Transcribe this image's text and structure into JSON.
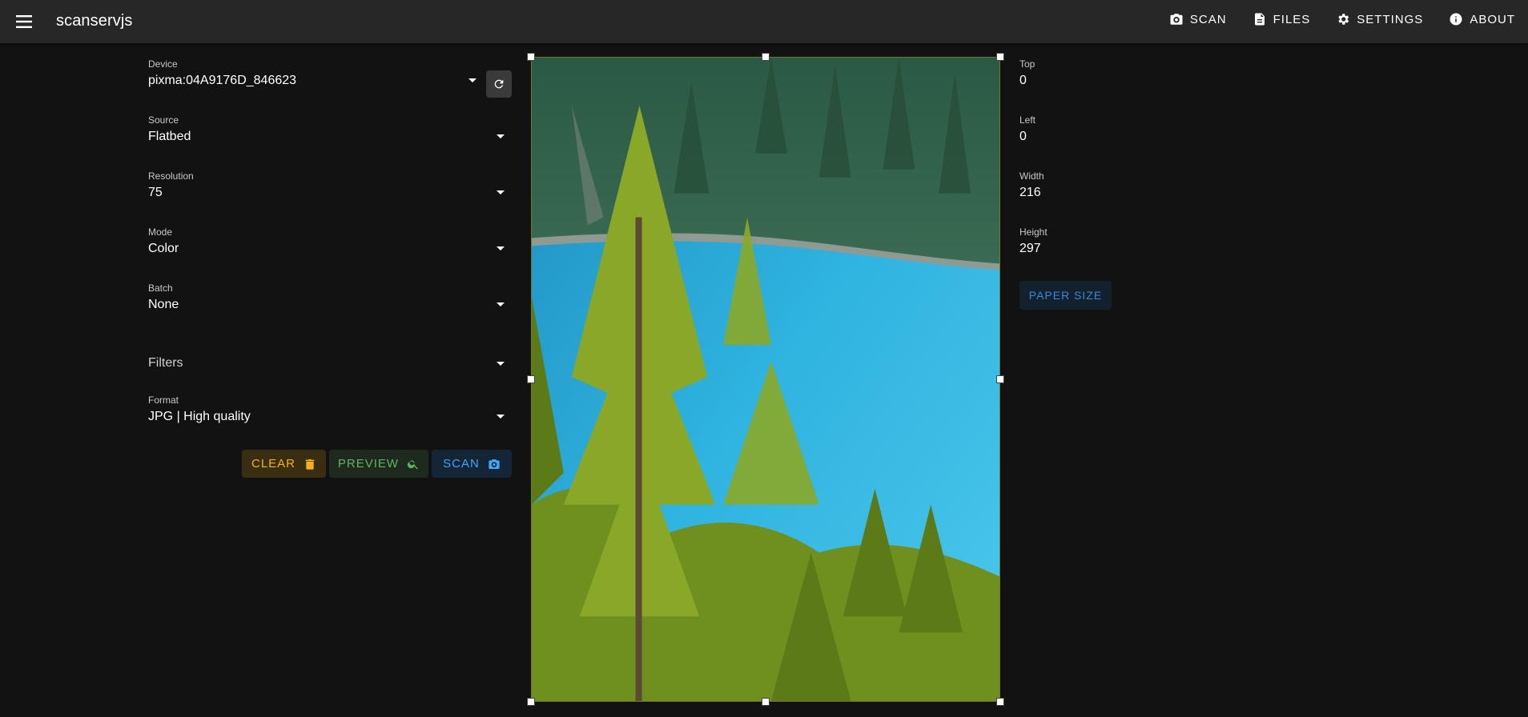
{
  "appbar": {
    "title": "scanservjs",
    "nav": [
      {
        "label": "SCAN",
        "icon": "camera-icon"
      },
      {
        "label": "FILES",
        "icon": "file-icon"
      },
      {
        "label": "SETTINGS",
        "icon": "gear-icon"
      },
      {
        "label": "ABOUT",
        "icon": "info-icon"
      }
    ]
  },
  "form": {
    "device": {
      "label": "Device",
      "value": "pixma:04A9176D_846623"
    },
    "source": {
      "label": "Source",
      "value": "Flatbed"
    },
    "resolution": {
      "label": "Resolution",
      "value": "75"
    },
    "mode": {
      "label": "Mode",
      "value": "Color"
    },
    "batch": {
      "label": "Batch",
      "value": "None"
    },
    "filters": {
      "label": "Filters"
    },
    "format": {
      "label": "Format",
      "value": "JPG | High quality"
    }
  },
  "actions": {
    "clear": "CLEAR",
    "preview": "PREVIEW",
    "scan": "SCAN"
  },
  "geometry": {
    "top": {
      "label": "Top",
      "value": "0"
    },
    "left": {
      "label": "Left",
      "value": "0"
    },
    "width": {
      "label": "Width",
      "value": "216"
    },
    "height": {
      "label": "Height",
      "value": "297"
    },
    "paper_size": "PAPER SIZE"
  },
  "colors": {
    "clear": "#f5b31a",
    "preview": "#5cb85c",
    "scan": "#42a5f5",
    "paper_size": "#3d87d6"
  }
}
